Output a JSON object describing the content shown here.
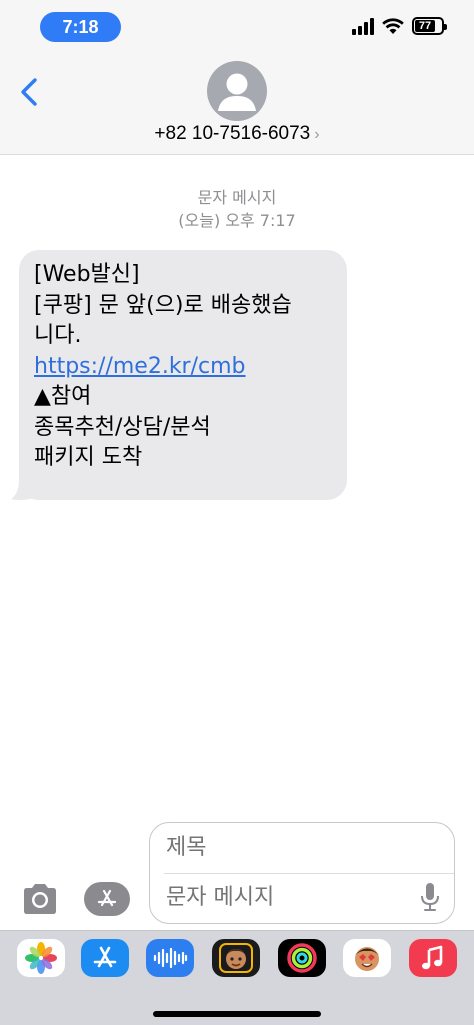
{
  "status_bar": {
    "time": "7:18",
    "battery_level": "77",
    "icons": [
      "signal-icon",
      "wifi-icon",
      "battery-icon"
    ]
  },
  "header": {
    "contact_number": "+82 10-7516-6073",
    "chevron": "›",
    "icons": [
      "back-chevron-icon",
      "contact-avatar-icon"
    ]
  },
  "thread": {
    "service_label": "문자 메시지",
    "timestamp": "(오늘) 오후 7:17",
    "message": {
      "line1": "[Web발신]",
      "line2": "[쿠팡] 문 앞(으)로 배송했습",
      "line3": "니다.",
      "link": "https://me2.kr/cmb",
      "line5": "▲참여",
      "line6": "종목추천/상담/분석",
      "line7": "패키지 도착"
    }
  },
  "composer": {
    "subject_placeholder": "제목",
    "body_placeholder": "문자 메시지",
    "icons": [
      "camera-icon",
      "app-store-icon",
      "microphone-icon"
    ]
  },
  "app_drawer": {
    "apps": [
      "photos-icon",
      "app-store-icon",
      "audio-message-icon",
      "memoji-icon",
      "activity-icon",
      "animoji-icon",
      "music-icon"
    ]
  },
  "colors": {
    "accent": "#2f7cf6",
    "link": "#2f6fdd",
    "bubble": "#e9e9eb",
    "header_bg": "#f6f6f6",
    "drawer_bg": "#d4d6dc"
  }
}
